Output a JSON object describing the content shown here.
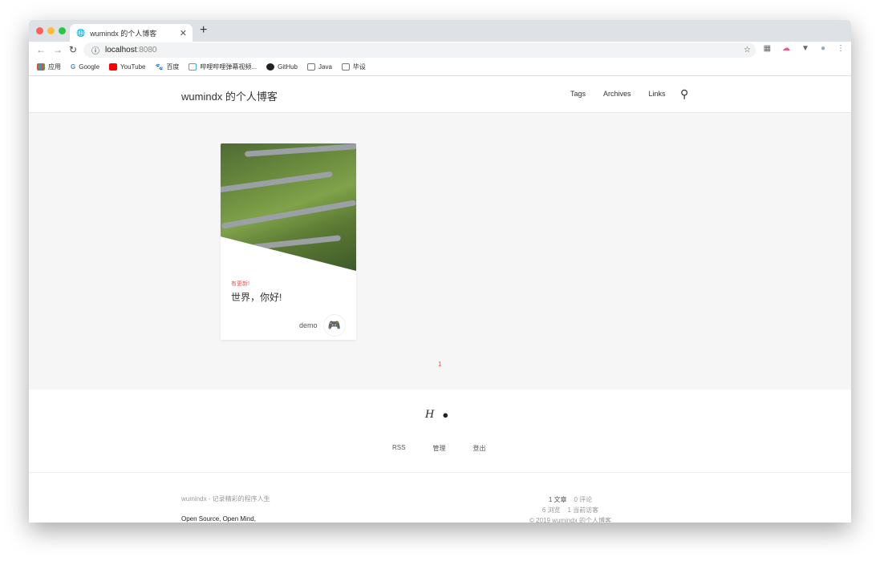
{
  "browser": {
    "tab_title": "wumindx 的个人博客",
    "url_host": "localhost",
    "url_port": ":8080",
    "bookmarks": [
      "应用",
      "Google",
      "YouTube",
      "百度",
      "哔哩哔哩弹幕视频...",
      "GitHub",
      "Java",
      "毕设"
    ]
  },
  "header": {
    "logo": "wumindx 的个人博客",
    "menu": [
      "Tags",
      "Archives",
      "Links"
    ]
  },
  "post": {
    "tag": "有更新!",
    "title": "世界，你好!",
    "author": "demo"
  },
  "pagination": {
    "current": "1"
  },
  "footer": {
    "links": [
      "RSS",
      "管理",
      "登出"
    ],
    "slogan": "wumindx - 记录精彩的程序人生",
    "motto": "Open Source, Open Mind,",
    "stats": {
      "articles": "1 文章",
      "comments": "0 评论",
      "views": "6 浏览",
      "visitors": "1 当前访客",
      "copyright": "© 2019 wumindx 的个人博客"
    }
  },
  "colors": {
    "accent": "#e35b5b"
  }
}
